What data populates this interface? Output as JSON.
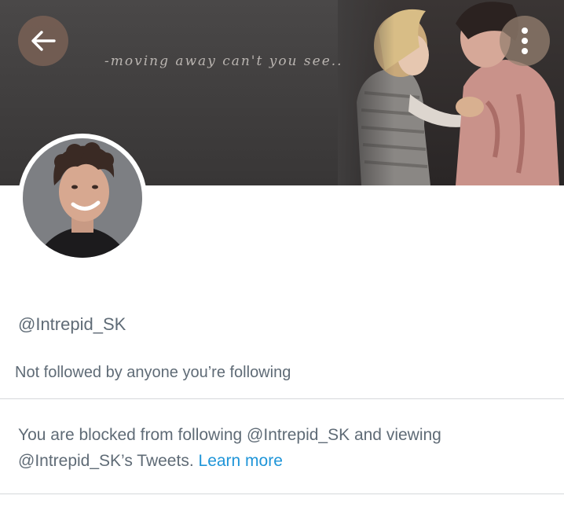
{
  "header": {
    "tagline": "-moving away can't you see..",
    "back_icon": "arrow-left-icon",
    "more_icon": "more-vertical-icon"
  },
  "profile": {
    "handle": "@Intrepid_SK",
    "followers_note": "Not followed by anyone you’re following"
  },
  "blocked_notice": {
    "line1": "You are blocked from following @Intrepid_SK and viewing",
    "line2": "@Intrepid_SK’s Tweets.",
    "link_label": "Learn more"
  },
  "colors": {
    "link": "#1f95d8",
    "text_secondary": "#5f6b76",
    "banner_bg": "#403e3e",
    "button_bg": "#786054"
  }
}
